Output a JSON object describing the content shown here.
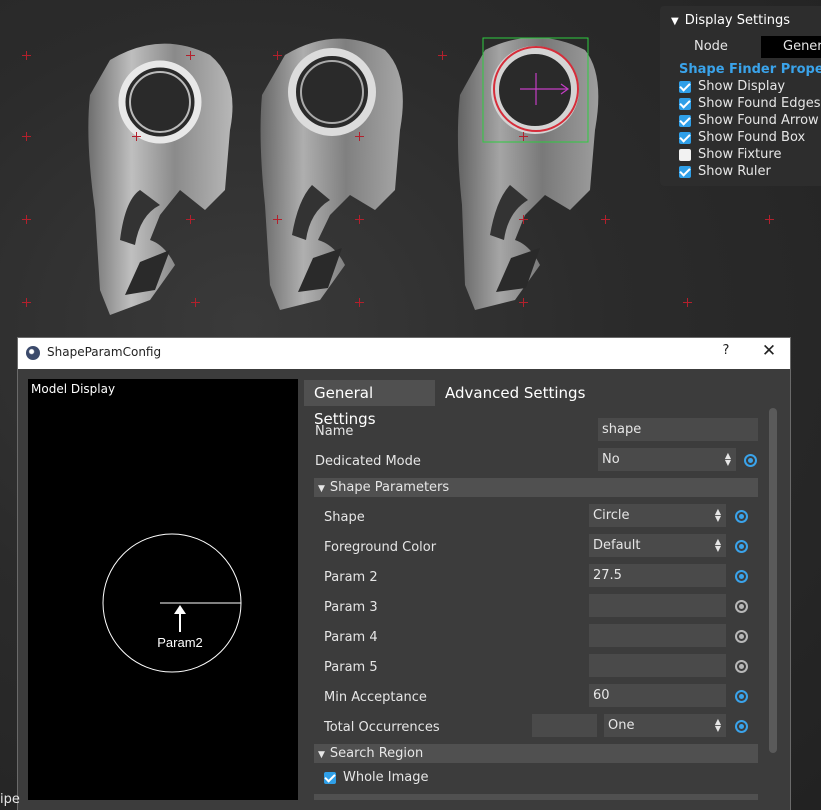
{
  "display_settings": {
    "title": "Display Settings",
    "tab_node": "Node",
    "tab_general": "General",
    "section": "Shape Finder Properties",
    "options": [
      {
        "label": "Show Display",
        "checked": true
      },
      {
        "label": "Show Found Edges",
        "checked": true
      },
      {
        "label": "Show Found Arrow",
        "checked": true
      },
      {
        "label": "Show Found Box",
        "checked": true
      },
      {
        "label": "Show Fixture",
        "checked": false
      },
      {
        "label": "Show Ruler",
        "checked": true
      }
    ]
  },
  "dialog": {
    "title": "ShapeParamConfig",
    "help": "?",
    "close": "✕",
    "model_display_label": "Model Display",
    "model_param_label": "Param2",
    "tabs": {
      "general": "General Settings",
      "advanced": "Advanced Settings"
    },
    "name": {
      "label": "Name",
      "value": "shape"
    },
    "dedicated_mode": {
      "label": "Dedicated Mode",
      "value": "No"
    },
    "shape_parameters": {
      "header": "Shape Parameters",
      "shape": {
        "label": "Shape",
        "value": "Circle"
      },
      "foreground_color": {
        "label": "Foreground Color",
        "value": "Default"
      },
      "param2": {
        "label": "Param 2",
        "value": "27.5"
      },
      "param3": {
        "label": "Param 3",
        "value": ""
      },
      "param4": {
        "label": "Param 4",
        "value": ""
      },
      "param5": {
        "label": "Param 5",
        "value": ""
      },
      "min_acceptance": {
        "label": "Min Acceptance",
        "value": "60"
      },
      "total_occurrences": {
        "label": "Total Occurrences",
        "value": "",
        "select": "One"
      }
    },
    "search_region": {
      "header": "Search Region",
      "whole_image": {
        "label": "Whole Image",
        "checked": true
      }
    }
  },
  "bottom_text": "ipe",
  "colors": {
    "accent": "#3aa3ea",
    "crosshair": "#b3202c",
    "box": "#2ecc40",
    "circle": "#d62d3a",
    "arrow": "#c43dc4"
  }
}
